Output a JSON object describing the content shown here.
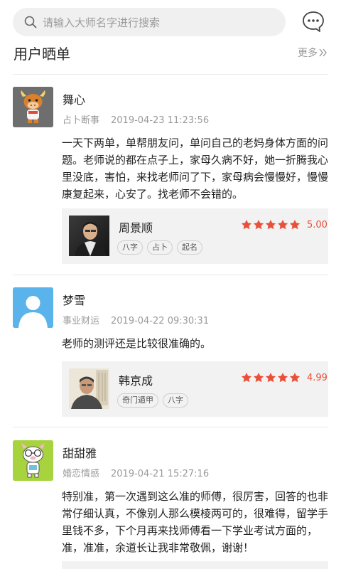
{
  "search": {
    "placeholder": "请输入大师名字进行搜索",
    "icon": "search-icon"
  },
  "header": {
    "chat_icon": "chat-bubble-icon"
  },
  "section": {
    "title": "用户晒单",
    "more_label": "更多",
    "more_icon": "double-chevron-right-icon"
  },
  "colors": {
    "accent": "#e8503a",
    "muted": "#9a9a9a",
    "card_bg": "#f2f2f2",
    "search_bg": "#f0f0f0"
  },
  "reviews": [
    {
      "user": "舞心",
      "category": "占卜断事",
      "date": "2019-04-23 11:23:56",
      "content": "一天下两单，单帮朋友问，单问自己的老妈身体方面的问题。老师说的都在点子上，家母久病不好，她一折腾我心里没底，害怕，来找老师问了下，家母病会慢慢好，慢慢康复起来，心安了。找老师不会错的。",
      "master": {
        "name": "周景顺",
        "rating": "5.00",
        "stars": 5,
        "tags": [
          "八字",
          "占卜",
          "起名"
        ]
      }
    },
    {
      "user": "梦雪",
      "category": "事业财运",
      "date": "2019-04-22 09:30:31",
      "content": "老师的测评还是比较很准确的。",
      "master": {
        "name": "韩京成",
        "rating": "4.99",
        "stars": 5,
        "tags": [
          "奇门遁甲",
          "八字"
        ]
      }
    },
    {
      "user": "甜甜雅",
      "category": "婚恋情感",
      "date": "2019-04-21 15:27:16",
      "content": "特别准，第一次遇到这么准的师傅，很厉害，回答的也非常仔细认真，不像别人那么模棱两可的，很难得，留学手里钱不多，下个月再来找师傅看一下学业考试方面的，准，准准，余道长让我非常敬佩，谢谢！"
    }
  ]
}
